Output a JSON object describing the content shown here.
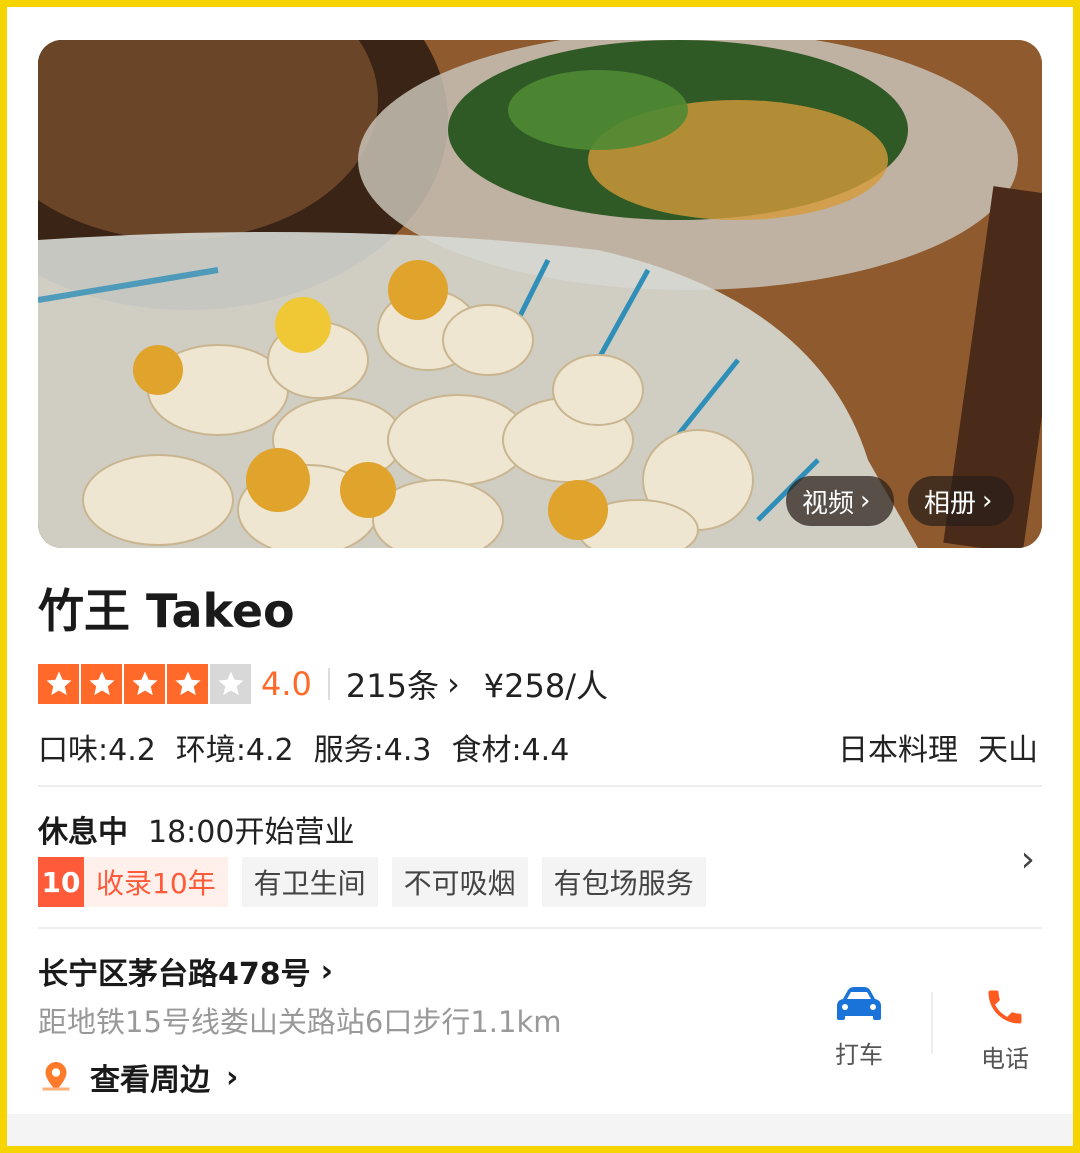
{
  "hero": {
    "video_label": "视频",
    "album_label": "相册"
  },
  "shop": {
    "name": "竹王 Takeo",
    "rating": "4.0",
    "rating_value": 4,
    "rating_max": 5,
    "review_count": "215条",
    "avg_price": "¥258/人",
    "sub_scores": [
      "口味:4.2",
      "环境:4.2",
      "服务:4.3",
      "食材:4.4"
    ],
    "cuisine": "日本料理",
    "area": "天山"
  },
  "hours": {
    "status": "休息中",
    "open_text": "18:00开始营业"
  },
  "tags": {
    "years_num": "10",
    "years_label": "收录10年",
    "items": [
      "有卫生间",
      "不可吸烟",
      "有包场服务"
    ]
  },
  "location": {
    "address": "长宁区茅台路478号",
    "distance": "距地铁15号线娄山关路站6口步行1.1km",
    "nearby_label": "查看周边"
  },
  "actions": {
    "taxi_label": "打车",
    "phone_label": "电话"
  },
  "colors": {
    "accent": "#ff6a2a",
    "tag_red": "#ff5a3a",
    "taxi_blue": "#1a73d9",
    "phone_orange": "#ff5a1f"
  },
  "icons": [
    "star-icon",
    "chevron-right-icon",
    "location-pin-icon",
    "car-icon",
    "phone-icon"
  ]
}
